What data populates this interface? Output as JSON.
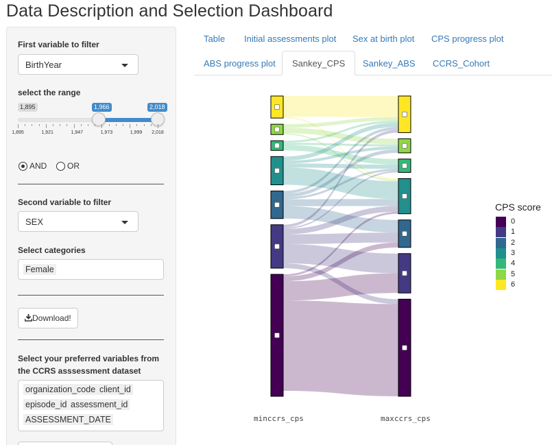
{
  "title": "Data Description and Selection Dashboard",
  "sidebar": {
    "filter1_label": "First variable to filter",
    "filter1_value": "BirthYear",
    "range_label": "select the range",
    "range": {
      "min": "1,895",
      "low": "1,966",
      "high": "2,018",
      "ticks": [
        "1,895",
        "1,921",
        "1,947",
        "1,973",
        "1,999",
        "2,018"
      ],
      "low_fraction": 0.577,
      "high_fraction": 1.0
    },
    "logic": {
      "and": "AND",
      "or": "OR",
      "selected": "AND"
    },
    "filter2_label": "Second variable to filter",
    "filter2_value": "SEX",
    "categories_label": "Select categories",
    "categories": [
      "Female"
    ],
    "download_label": "Download!",
    "variables_label_line1": "Select your preferred variables from",
    "variables_label_line2": "the CCRS asssessment dataset",
    "variables": [
      "organization_code",
      "client_id",
      "episode_id",
      "assessment_id",
      "ASSESSMENT_DATE"
    ]
  },
  "tabs": {
    "row1": [
      "Table",
      "Initial assessments plot",
      "Sex at birth plot",
      "CPS progress plot"
    ],
    "row2": [
      "ABS progress plot",
      "Sankey_CPS",
      "Sankey_ABS",
      "CCRS_Cohort"
    ],
    "active": "Sankey_CPS"
  },
  "chart_data": {
    "type": "sankey",
    "axis_labels": [
      "minccrs_cps",
      "maxccrs_cps"
    ],
    "legend_title": "CPS score",
    "categories": [
      "0",
      "1",
      "2",
      "3",
      "4",
      "5",
      "6"
    ],
    "colors": [
      "#440154",
      "#443a83",
      "#31688e",
      "#21908d",
      "#35b779",
      "#8fd744",
      "#fde725"
    ],
    "left_nodes_top_to_bottom": [
      "6",
      "5",
      "4",
      "3",
      "2",
      "1",
      "0"
    ],
    "right_nodes_top_to_bottom": [
      "6",
      "5",
      "4",
      "3",
      "2",
      "1",
      "0"
    ],
    "left_totals": {
      "6": 32,
      "5": 15,
      "4": 14,
      "3": 41,
      "2": 40,
      "1": 63,
      "0": 177
    },
    "right_totals": {
      "6": 52,
      "5": 20,
      "4": 19,
      "3": 50,
      "2": 39,
      "1": 56,
      "0": 138
    },
    "flows": [
      {
        "from": "6",
        "to": "6",
        "value": 30
      },
      {
        "from": "6",
        "to": "3",
        "value": 2
      },
      {
        "from": "5",
        "to": "5",
        "value": 8
      },
      {
        "from": "5",
        "to": "6",
        "value": 5
      },
      {
        "from": "5",
        "to": "3",
        "value": 2
      },
      {
        "from": "4",
        "to": "4",
        "value": 8
      },
      {
        "from": "4",
        "to": "6",
        "value": 3
      },
      {
        "from": "4",
        "to": "5",
        "value": 3
      },
      {
        "from": "3",
        "to": "3",
        "value": 25
      },
      {
        "from": "3",
        "to": "6",
        "value": 6
      },
      {
        "from": "3",
        "to": "5",
        "value": 4
      },
      {
        "from": "3",
        "to": "4",
        "value": 6
      },
      {
        "from": "2",
        "to": "2",
        "value": 18
      },
      {
        "from": "2",
        "to": "3",
        "value": 10
      },
      {
        "from": "2",
        "to": "6",
        "value": 4
      },
      {
        "from": "2",
        "to": "4",
        "value": 3
      },
      {
        "from": "2",
        "to": "5",
        "value": 5
      },
      {
        "from": "1",
        "to": "1",
        "value": 28
      },
      {
        "from": "1",
        "to": "2",
        "value": 14
      },
      {
        "from": "1",
        "to": "3",
        "value": 8
      },
      {
        "from": "1",
        "to": "6",
        "value": 4
      },
      {
        "from": "1",
        "to": "4",
        "value": 2
      },
      {
        "from": "1",
        "to": "0",
        "value": 7
      },
      {
        "from": "0",
        "to": "0",
        "value": 131
      },
      {
        "from": "0",
        "to": "1",
        "value": 28
      },
      {
        "from": "0",
        "to": "2",
        "value": 7
      },
      {
        "from": "0",
        "to": "3",
        "value": 3
      },
      {
        "from": "0",
        "to": "6",
        "value": 0
      },
      {
        "from": "0",
        "to": "5",
        "value": 0
      },
      {
        "from": "0",
        "to": "4",
        "value": 0
      }
    ]
  }
}
